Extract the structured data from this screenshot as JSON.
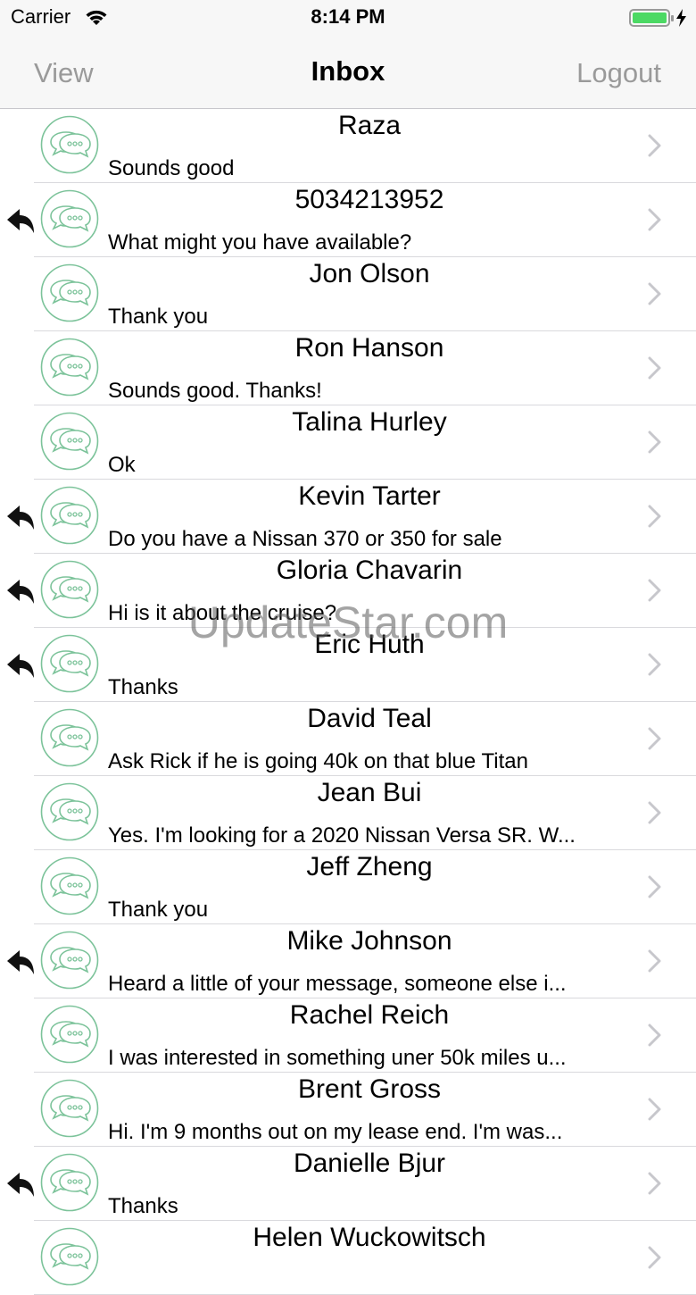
{
  "status_bar": {
    "carrier": "Carrier",
    "time": "8:14 PM",
    "icons": [
      "wifi-icon",
      "battery-icon",
      "charging-bolt-icon"
    ]
  },
  "nav": {
    "left_label": "View",
    "title": "Inbox",
    "right_label": "Logout"
  },
  "colors": {
    "avatar_green": "#7cc39a",
    "battery_green": "#4cd964",
    "chevron_gray": "#c7c7cc",
    "nav_button_gray": "#9a9a9a"
  },
  "conversations": [
    {
      "name": "Raza",
      "preview": "Sounds good",
      "replied": false
    },
    {
      "name": "5034213952",
      "preview": "What might you have available?",
      "replied": true
    },
    {
      "name": "Jon Olson",
      "preview": "Thank you",
      "replied": false
    },
    {
      "name": "Ron Hanson",
      "preview": "Sounds good. Thanks!",
      "replied": false
    },
    {
      "name": "Talina Hurley",
      "preview": "Ok",
      "replied": false
    },
    {
      "name": "Kevin Tarter",
      "preview": "Do you have a Nissan 370 or 350 for sale",
      "replied": true
    },
    {
      "name": "Gloria Chavarin",
      "preview": "Hi is it about the cruise?",
      "replied": true
    },
    {
      "name": "Eric Huth",
      "preview": "Thanks",
      "replied": true
    },
    {
      "name": "David Teal",
      "preview": "Ask Rick if he is going 40k on that blue Titan",
      "replied": false
    },
    {
      "name": "Jean Bui",
      "preview": "Yes. I'm looking for a 2020 Nissan Versa SR. W...",
      "replied": false
    },
    {
      "name": "Jeff Zheng",
      "preview": "Thank you",
      "replied": false
    },
    {
      "name": "Mike Johnson",
      "preview": "Heard a little of your message, someone else i...",
      "replied": true
    },
    {
      "name": "Rachel Reich",
      "preview": "I was interested in something uner 50k miles u...",
      "replied": false
    },
    {
      "name": "Brent Gross",
      "preview": "Hi. I'm 9 months out on my lease end.  I'm was...",
      "replied": false
    },
    {
      "name": "Danielle Bjur",
      "preview": "Thanks",
      "replied": true
    },
    {
      "name": "Helen Wuckowitsch",
      "preview": "",
      "replied": false
    }
  ],
  "watermark": "UpdateStar.com"
}
